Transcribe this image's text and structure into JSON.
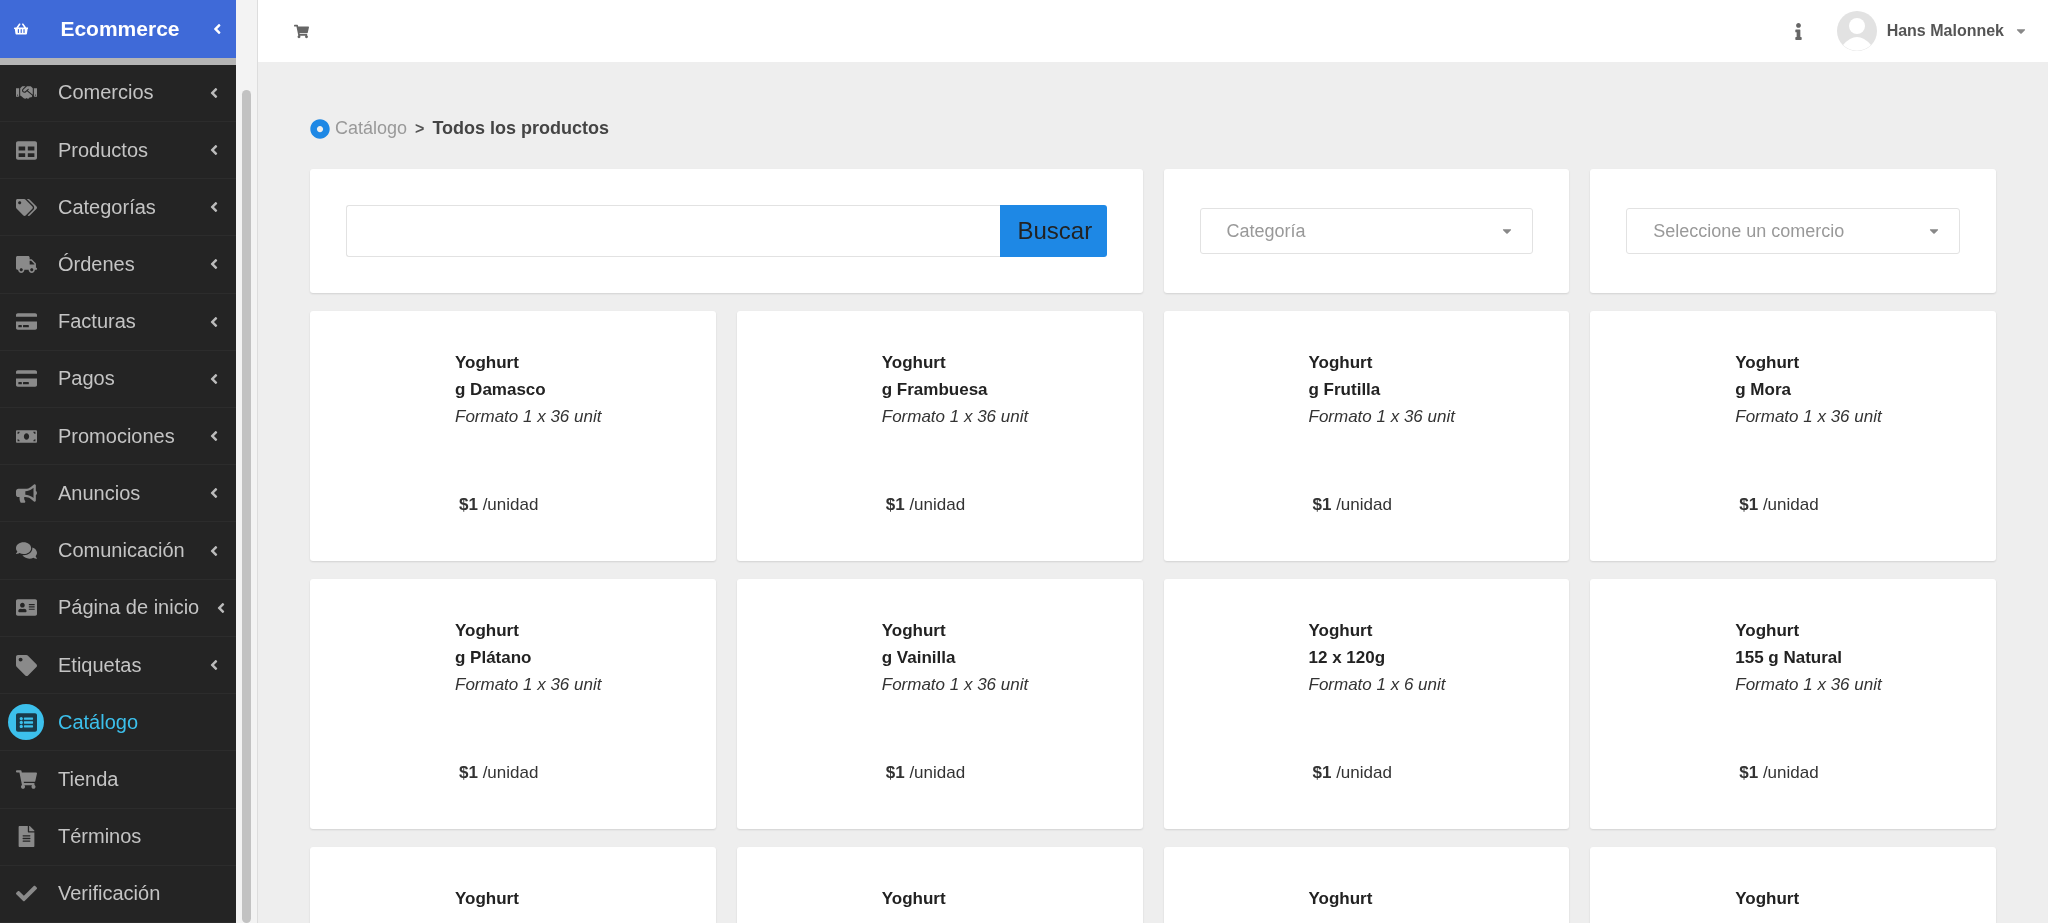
{
  "sidebar": {
    "brand": {
      "label": "Ecommerce",
      "expandable": true
    },
    "items": [
      {
        "label": "Comercios",
        "expandable": true,
        "selected": false
      },
      {
        "label": "Productos",
        "expandable": true,
        "selected": false
      },
      {
        "label": "Categorías",
        "expandable": true,
        "selected": false
      },
      {
        "label": "Órdenes",
        "expandable": true,
        "selected": false
      },
      {
        "label": "Facturas",
        "expandable": true,
        "selected": false
      },
      {
        "label": "Pagos",
        "expandable": true,
        "selected": false
      },
      {
        "label": "Promociones",
        "expandable": true,
        "selected": false
      },
      {
        "label": "Anuncios",
        "expandable": true,
        "selected": false
      },
      {
        "label": "Comunicación",
        "expandable": true,
        "selected": false
      },
      {
        "label": "Página de inicio",
        "expandable": true,
        "selected": false
      },
      {
        "label": "Etiquetas",
        "expandable": true,
        "selected": false
      },
      {
        "label": "Catálogo",
        "expandable": false,
        "selected": true
      },
      {
        "label": "Tienda",
        "expandable": false,
        "selected": false
      },
      {
        "label": "Términos",
        "expandable": false,
        "selected": false
      },
      {
        "label": "Verificación",
        "expandable": false,
        "selected": false
      }
    ]
  },
  "topbar": {
    "user": "Hans Malonnek"
  },
  "breadcrumb": {
    "parent": "Catálogo",
    "separator": ">",
    "current": "Todos los productos"
  },
  "filters": {
    "search": {
      "button": "Buscar"
    },
    "category": {
      "placeholder": "Categoría"
    },
    "store": {
      "placeholder": "Seleccione un comercio"
    }
  },
  "products": [
    {
      "title": "Yoghurt",
      "subtitle": "g Damasco",
      "format": "Formato 1 x 36 unit",
      "price": "**$1** /unidad"
    },
    {
      "title": "Yoghurt",
      "subtitle": "g Frambuesa",
      "format": "Formato 1 x 36 unit",
      "price": "**$1** /unidad"
    },
    {
      "title": "Yoghurt",
      "subtitle": "g Frutilla",
      "format": "Formato 1 x 36 unit",
      "price": "**$1** /unidad"
    },
    {
      "title": "Yoghurt",
      "subtitle": "g Mora",
      "format": "Formato 1 x 36 unit",
      "price": "**$1** /unidad"
    },
    {
      "title": "Yoghurt",
      "subtitle": "g Plátano",
      "format": "Formato 1 x 36 unit",
      "price": "**$1** /unidad"
    },
    {
      "title": "Yoghurt",
      "subtitle": "g Vainilla",
      "format": "Formato 1 x 36 unit",
      "price": "**$1** /unidad"
    },
    {
      "title": "Yoghurt",
      "subtitle": "12 x 120g",
      "format": "Formato 1 x 6 unit",
      "price": "**$1** /unidad"
    },
    {
      "title": "Yoghurt",
      "subtitle": "155 g Natural",
      "format": "Formato 1 x 36 unit",
      "price": "**$1** /unidad"
    },
    {
      "title": "Yoghurt"
    },
    {
      "title": "Yoghurt"
    },
    {
      "title": "Yoghurt"
    },
    {
      "title": "Yoghurt"
    }
  ]
}
